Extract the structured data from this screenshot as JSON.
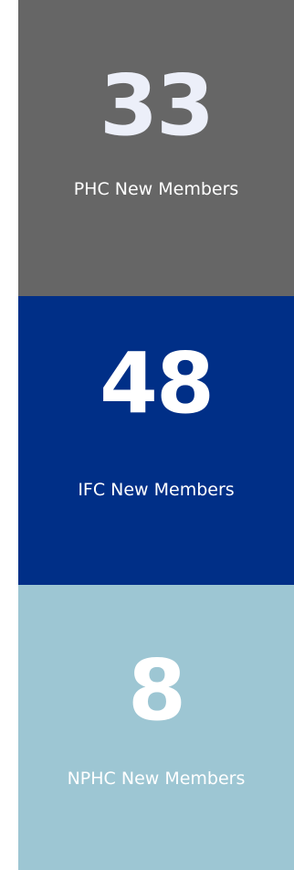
{
  "cards": [
    {
      "number": "33",
      "label": "PHC New Members",
      "bg": "#666666"
    },
    {
      "number": "48",
      "label": "IFC New Members",
      "bg": "#002f87"
    },
    {
      "number": "8",
      "label": "NPHC New Members",
      "bg": "#9dc6d3"
    }
  ]
}
